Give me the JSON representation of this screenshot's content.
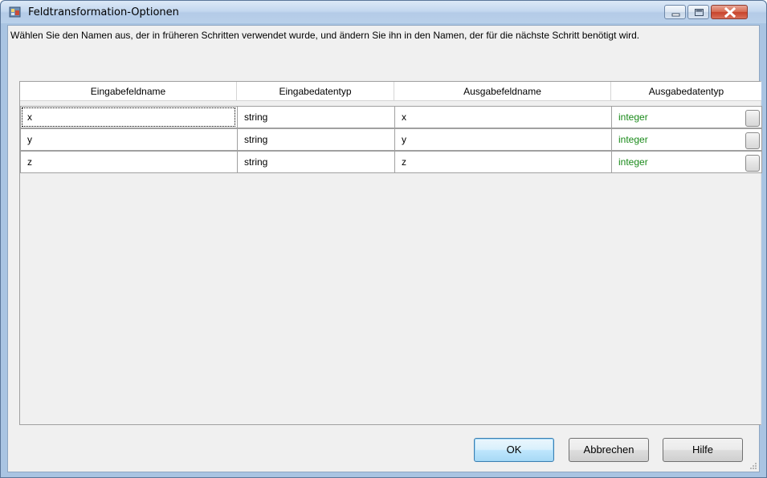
{
  "window": {
    "title": "Feldtransformation-Optionen",
    "icon": "app-icon",
    "controls": [
      "minimize-icon",
      "maximize-icon",
      "close-icon"
    ]
  },
  "description": "Wählen Sie den Namen aus, der in früheren Schritten verwendet wurde, und ändern Sie ihn in den Namen, der für die nächste Schritt benötigt wird.",
  "grid": {
    "columns": [
      "Eingabefeldname",
      "Eingabedatentyp",
      "Ausgabefeldname",
      "Ausgabedatentyp"
    ],
    "rows": [
      {
        "input_name": "x",
        "input_type": "string",
        "output_name": "x",
        "output_type": "integer"
      },
      {
        "input_name": "y",
        "input_type": "string",
        "output_name": "y",
        "output_type": "integer"
      },
      {
        "input_name": "z",
        "input_type": "string",
        "output_name": "z",
        "output_type": "integer"
      }
    ],
    "output_type_color": "#1a8a1a"
  },
  "buttons": {
    "ok": "OK",
    "cancel": "Abbrechen",
    "help": "Hilfe"
  }
}
